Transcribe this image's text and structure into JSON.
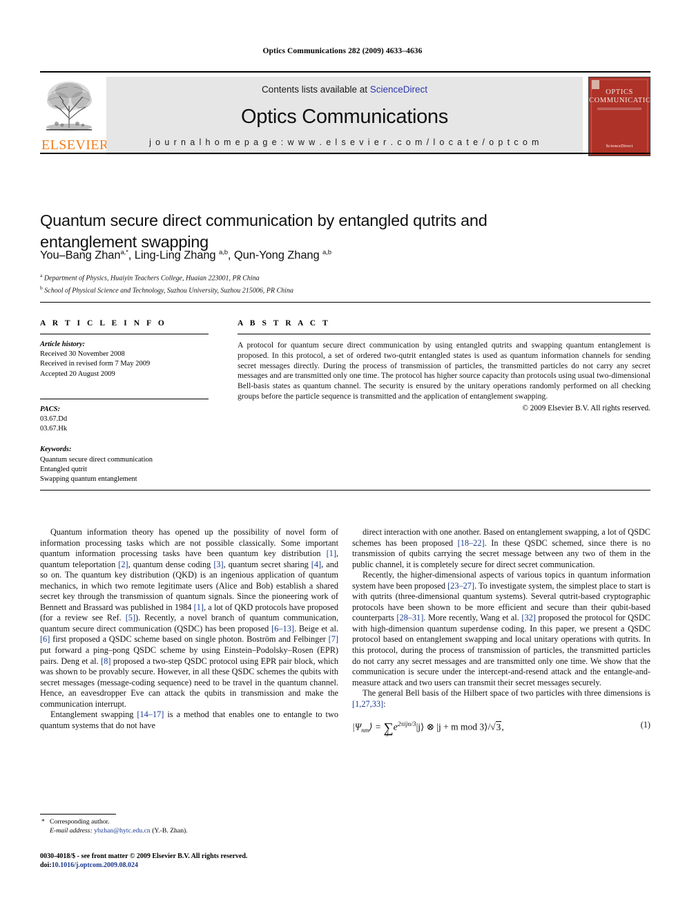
{
  "running_head": "Optics Communications 282 (2009) 4633–4636",
  "masthead": {
    "publisher_name": "ELSEVIER",
    "contents_prefix": "Contents lists available at ",
    "contents_link": "ScienceDirect",
    "journal_name": "Optics Communications",
    "homepage": "j o u r n a l  h o m e p a g e :  w w w . e l s e v i e r . c o m / l o c a t e / o p t c o m",
    "cover": {
      "line1": "OPTICS",
      "line2": "COMMUNICATIONS",
      "badge": "ScienceDirect"
    }
  },
  "article": {
    "title": "Quantum secure direct communication by entangled qutrits and entanglement swapping",
    "authors_html": "You–Bang Zhan<sup>a,*</sup>, Ling-Ling Zhang <sup>a,b</sup>, Qun-Yong Zhang <sup>a,b</sup>",
    "affiliation_a": "Department of Physics, Huaiyin Teachers College, Huaian 223001, PR China",
    "affiliation_b": "School of Physical Science and Technology, Suzhou University, Suzhou 215006, PR China"
  },
  "article_info": {
    "heading": "A R T I C L E   I N F O",
    "history_label": "Article history:",
    "history": [
      "Received 30 November 2008",
      "Received in revised form 7 May 2009",
      "Accepted 20 August 2009"
    ],
    "pacs_label": "PACS:",
    "pacs": [
      "03.67.Dd",
      "03.67.Hk"
    ],
    "keywords_label": "Keywords:",
    "keywords": [
      "Quantum secure direct communication",
      "Entangled qutrit",
      "Swapping quantum entanglement"
    ]
  },
  "abstract": {
    "heading": "A B S T R A C T",
    "text": "A protocol for quantum secure direct communication by using entangled qutrits and swapping quantum entanglement is proposed. In this protocol, a set of ordered two-qutrit entangled states is used as quantum information channels for sending secret messages directly. During the process of transmission of particles, the transmitted particles do not carry any secret messages and are transmitted only one time. The protocol has higher source capacity than protocols using usual two-dimensional Bell-basis states as quantum channel. The security is ensured by the unitary operations randomly performed on all checking groups before the particle sequence is transmitted and the application of entanglement swapping.",
    "copyright": "© 2009 Elsevier B.V. All rights reserved."
  },
  "body": {
    "left": {
      "p1_parts": [
        "Quantum information theory has opened up the possibility of novel form of information processing tasks which are not possible classically. Some important quantum information processing tasks have been quantum key distribution ",
        "[1]",
        ", quantum teleportation ",
        "[2]",
        ", quantum dense coding ",
        "[3]",
        ", quantum secret sharing ",
        "[4]",
        ", and so on. The quantum key distribution (QKD) is an ingenious application of quantum mechanics, in which two remote legitimate users (Alice and Bob) establish a shared secret key through the transmission of quantum signals. Since the pioneering work of Bennett and Brassard was published in 1984 ",
        "[1]",
        ", a lot of QKD protocols have proposed (for a review see Ref. ",
        "[5]",
        "). Recently, a novel branch of quantum communication, quantum secure direct communication (QSDC) has been proposed ",
        "[6–13]",
        ". Beige et al. ",
        "[6]",
        " first proposed a QSDC scheme based on single photon. Boström and Felbinger ",
        "[7]",
        " put forward a ping–pong QSDC scheme by using Einstein–Podolsky–Rosen (EPR) pairs. Deng et al. ",
        "[8]",
        " proposed a two-step QSDC protocol using EPR pair block, which was shown to be provably secure. However, in all these QSDC schemes the qubits with secret messages (message-coding sequence) need to be travel in the quantum channel. Hence, an eavesdropper Eve can attack the qubits in transmission and make the communication interrupt."
      ],
      "p2_parts": [
        "Entanglement swapping ",
        "[14–17]",
        " is a method that enables one to entangle to two quantum systems that do not have"
      ]
    },
    "right": {
      "p1_parts": [
        "direct interaction with one another. Based on entanglement swapping, a lot of QSDC schemes has been proposed ",
        "[18–22]",
        ". In these QSDC schemed, since there is no transmission of qubits carrying the secret message between any two of them in the public channel, it is completely secure for direct secret communication."
      ],
      "p2_parts": [
        "Recently, the higher-dimensional aspects of various topics in quantum information system have been proposed ",
        "[23–27]",
        ". To investigate system, the simplest place to start is with qutrits (three-dimensional quantum systems). Several qutrit-based cryptographic protocols have been shown to be more efficient and secure than their qubit-based counterparts ",
        "[28–31]",
        ". More recently, Wang et al. ",
        "[32]",
        " proposed the protocol for QSDC with high-dimension quantum superdense coding. In this paper, we present a QSDC protocol based on entanglement swapping and local unitary operations with qutrits. In this protocol, during the process of transmission of particles, the transmitted particles do not carry any secret messages and are transmitted only one time. We show that the communication is secure under the intercept-and-resend attack and the entangle-and-measure attack and two users can transmit their secret messages securely."
      ],
      "p3_parts": [
        "The general Bell basis of the Hilbert space of two particles with three dimensions is ",
        "[1,27,33]",
        ":"
      ]
    }
  },
  "equation": {
    "number": "(1)",
    "lhs": "|Ψ",
    "lhs_sub": "nm",
    "lhs_close": "⟩ = ",
    "sum_index": "j",
    "exp_base": "e",
    "exp_sup": "2πijn/3",
    "ket_j": "|j⟩ ⊗ |j + m mod 3⟩",
    "divider": "/",
    "sqrt_arg": "3",
    "trailer": ","
  },
  "footnote": {
    "star": "*",
    "corresponding": "Corresponding author.",
    "email_label": "E-mail address:",
    "email": "ybzhan@hytc.edu.cn",
    "email_attrib": "(Y.-B. Zhan)."
  },
  "footer": {
    "issn_line": "0030-4018/$ - see front matter © 2009 Elsevier B.V. All rights reserved.",
    "doi_label": "doi:",
    "doi": "10.1016/j.optcom.2009.08.024"
  },
  "colors": {
    "link_blue": "#2b35b0",
    "reference_blue": "#1a3a8f",
    "elsevier_orange": "#f07c1a",
    "cover_red": "#ae3228",
    "banner_gray": "#e6e6e6"
  }
}
